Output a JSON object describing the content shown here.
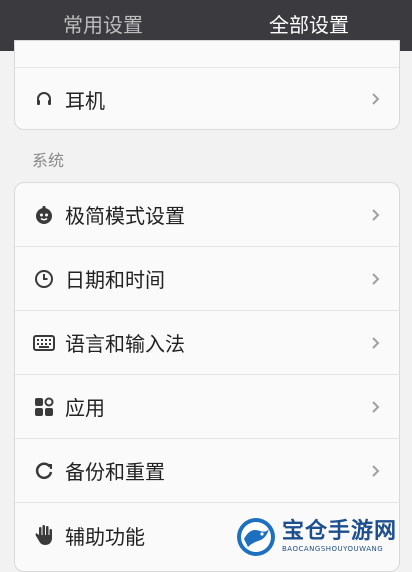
{
  "tabs": [
    {
      "label": "常用设置",
      "active": false
    },
    {
      "label": "全部设置",
      "active": true
    }
  ],
  "top_card": {
    "items": [
      {
        "label": "耳机",
        "icon": "headphones-icon"
      }
    ]
  },
  "system_section": {
    "title": "系统",
    "items": [
      {
        "label": "极简模式设置",
        "icon": "minimal-mode-icon"
      },
      {
        "label": "日期和时间",
        "icon": "clock-icon"
      },
      {
        "label": "语言和输入法",
        "icon": "keyboard-icon"
      },
      {
        "label": "应用",
        "icon": "apps-icon"
      },
      {
        "label": "备份和重置",
        "icon": "backup-reset-icon"
      },
      {
        "label": "辅助功能",
        "icon": "accessibility-hand-icon"
      }
    ]
  },
  "watermark": {
    "title": "宝仓手游网",
    "subtitle": "BAOCANGSHOUYOUWANG"
  },
  "colors": {
    "tabbar_bg": "#3b3b3f",
    "page_bg": "#f2f2f2",
    "card_bg": "#fafafa",
    "watermark_blue": "#1d4f8f"
  }
}
